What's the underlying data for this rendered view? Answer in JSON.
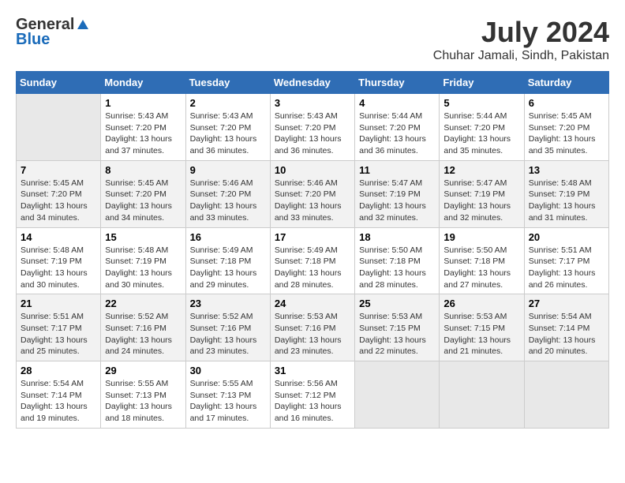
{
  "header": {
    "logo_general": "General",
    "logo_blue": "Blue",
    "month_title": "July 2024",
    "location": "Chuhar Jamali, Sindh, Pakistan"
  },
  "days_of_week": [
    "Sunday",
    "Monday",
    "Tuesday",
    "Wednesday",
    "Thursday",
    "Friday",
    "Saturday"
  ],
  "weeks": [
    [
      {
        "day": "",
        "info": ""
      },
      {
        "day": "1",
        "info": "Sunrise: 5:43 AM\nSunset: 7:20 PM\nDaylight: 13 hours\nand 37 minutes."
      },
      {
        "day": "2",
        "info": "Sunrise: 5:43 AM\nSunset: 7:20 PM\nDaylight: 13 hours\nand 36 minutes."
      },
      {
        "day": "3",
        "info": "Sunrise: 5:43 AM\nSunset: 7:20 PM\nDaylight: 13 hours\nand 36 minutes."
      },
      {
        "day": "4",
        "info": "Sunrise: 5:44 AM\nSunset: 7:20 PM\nDaylight: 13 hours\nand 36 minutes."
      },
      {
        "day": "5",
        "info": "Sunrise: 5:44 AM\nSunset: 7:20 PM\nDaylight: 13 hours\nand 35 minutes."
      },
      {
        "day": "6",
        "info": "Sunrise: 5:45 AM\nSunset: 7:20 PM\nDaylight: 13 hours\nand 35 minutes."
      }
    ],
    [
      {
        "day": "7",
        "info": "Sunrise: 5:45 AM\nSunset: 7:20 PM\nDaylight: 13 hours\nand 34 minutes."
      },
      {
        "day": "8",
        "info": "Sunrise: 5:45 AM\nSunset: 7:20 PM\nDaylight: 13 hours\nand 34 minutes."
      },
      {
        "day": "9",
        "info": "Sunrise: 5:46 AM\nSunset: 7:20 PM\nDaylight: 13 hours\nand 33 minutes."
      },
      {
        "day": "10",
        "info": "Sunrise: 5:46 AM\nSunset: 7:20 PM\nDaylight: 13 hours\nand 33 minutes."
      },
      {
        "day": "11",
        "info": "Sunrise: 5:47 AM\nSunset: 7:19 PM\nDaylight: 13 hours\nand 32 minutes."
      },
      {
        "day": "12",
        "info": "Sunrise: 5:47 AM\nSunset: 7:19 PM\nDaylight: 13 hours\nand 32 minutes."
      },
      {
        "day": "13",
        "info": "Sunrise: 5:48 AM\nSunset: 7:19 PM\nDaylight: 13 hours\nand 31 minutes."
      }
    ],
    [
      {
        "day": "14",
        "info": "Sunrise: 5:48 AM\nSunset: 7:19 PM\nDaylight: 13 hours\nand 30 minutes."
      },
      {
        "day": "15",
        "info": "Sunrise: 5:48 AM\nSunset: 7:19 PM\nDaylight: 13 hours\nand 30 minutes."
      },
      {
        "day": "16",
        "info": "Sunrise: 5:49 AM\nSunset: 7:18 PM\nDaylight: 13 hours\nand 29 minutes."
      },
      {
        "day": "17",
        "info": "Sunrise: 5:49 AM\nSunset: 7:18 PM\nDaylight: 13 hours\nand 28 minutes."
      },
      {
        "day": "18",
        "info": "Sunrise: 5:50 AM\nSunset: 7:18 PM\nDaylight: 13 hours\nand 28 minutes."
      },
      {
        "day": "19",
        "info": "Sunrise: 5:50 AM\nSunset: 7:18 PM\nDaylight: 13 hours\nand 27 minutes."
      },
      {
        "day": "20",
        "info": "Sunrise: 5:51 AM\nSunset: 7:17 PM\nDaylight: 13 hours\nand 26 minutes."
      }
    ],
    [
      {
        "day": "21",
        "info": "Sunrise: 5:51 AM\nSunset: 7:17 PM\nDaylight: 13 hours\nand 25 minutes."
      },
      {
        "day": "22",
        "info": "Sunrise: 5:52 AM\nSunset: 7:16 PM\nDaylight: 13 hours\nand 24 minutes."
      },
      {
        "day": "23",
        "info": "Sunrise: 5:52 AM\nSunset: 7:16 PM\nDaylight: 13 hours\nand 23 minutes."
      },
      {
        "day": "24",
        "info": "Sunrise: 5:53 AM\nSunset: 7:16 PM\nDaylight: 13 hours\nand 23 minutes."
      },
      {
        "day": "25",
        "info": "Sunrise: 5:53 AM\nSunset: 7:15 PM\nDaylight: 13 hours\nand 22 minutes."
      },
      {
        "day": "26",
        "info": "Sunrise: 5:53 AM\nSunset: 7:15 PM\nDaylight: 13 hours\nand 21 minutes."
      },
      {
        "day": "27",
        "info": "Sunrise: 5:54 AM\nSunset: 7:14 PM\nDaylight: 13 hours\nand 20 minutes."
      }
    ],
    [
      {
        "day": "28",
        "info": "Sunrise: 5:54 AM\nSunset: 7:14 PM\nDaylight: 13 hours\nand 19 minutes."
      },
      {
        "day": "29",
        "info": "Sunrise: 5:55 AM\nSunset: 7:13 PM\nDaylight: 13 hours\nand 18 minutes."
      },
      {
        "day": "30",
        "info": "Sunrise: 5:55 AM\nSunset: 7:13 PM\nDaylight: 13 hours\nand 17 minutes."
      },
      {
        "day": "31",
        "info": "Sunrise: 5:56 AM\nSunset: 7:12 PM\nDaylight: 13 hours\nand 16 minutes."
      },
      {
        "day": "",
        "info": ""
      },
      {
        "day": "",
        "info": ""
      },
      {
        "day": "",
        "info": ""
      }
    ]
  ]
}
